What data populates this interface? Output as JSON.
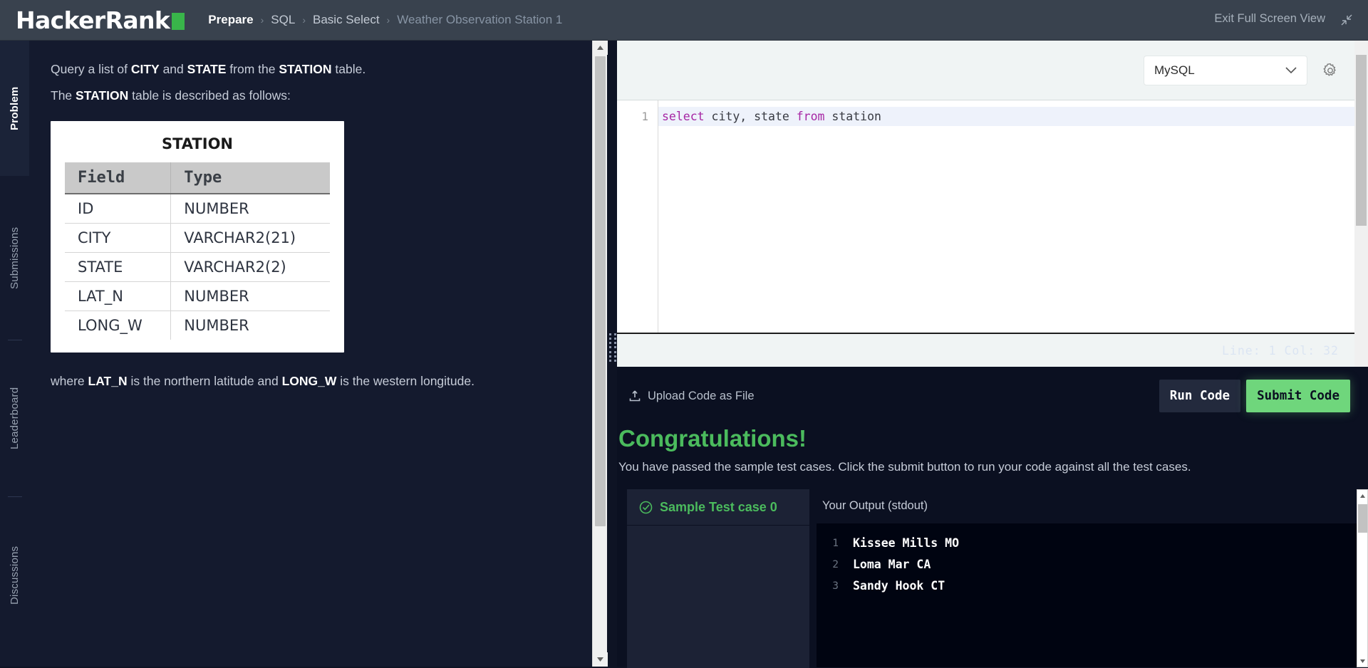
{
  "header": {
    "logo_text": "HackerRank",
    "breadcrumb": [
      {
        "label": "Prepare",
        "state": "strong"
      },
      {
        "label": "SQL",
        "state": "normal"
      },
      {
        "label": "Basic Select",
        "state": "normal"
      },
      {
        "label": "Weather Observation Station 1",
        "state": "current"
      }
    ],
    "separator": "›",
    "exit_fullscreen_label": "Exit Full Screen View",
    "exit_fullscreen_icon": "collapse-arrows-icon"
  },
  "rail": {
    "items": [
      {
        "label": "Problem",
        "active": true
      },
      {
        "label": "Submissions",
        "active": false
      },
      {
        "label": "Leaderboard",
        "active": false
      },
      {
        "label": "Discussions",
        "active": false
      }
    ]
  },
  "problem": {
    "line1_a": "Query a list of ",
    "line1_b": "CITY",
    "line1_c": " and ",
    "line1_d": "STATE",
    "line1_e": " from the ",
    "line1_f": "STATION",
    "line1_g": " table.",
    "line2_a": "The ",
    "line2_b": "STATION",
    "line2_c": " table is described as follows:",
    "table_image": {
      "title": "STATION",
      "headers": [
        "Field",
        "Type"
      ],
      "rows": [
        [
          "ID",
          "NUMBER"
        ],
        [
          "CITY",
          "VARCHAR2(21)"
        ],
        [
          "STATE",
          "VARCHAR2(2)"
        ],
        [
          "LAT_N",
          "NUMBER"
        ],
        [
          "LONG_W",
          "NUMBER"
        ]
      ]
    },
    "footnote_a": "where ",
    "footnote_b": "LAT_N",
    "footnote_c": " is the northern latitude and ",
    "footnote_d": "LONG_W",
    "footnote_e": " is the western longitude."
  },
  "editor": {
    "language": "MySQL",
    "language_chevron": "chevron-down-icon",
    "settings_icon": "gear-icon",
    "gutter": [
      "1"
    ],
    "code_tokens": [
      {
        "text": "select",
        "type": "keyword"
      },
      {
        "text": " city, state ",
        "type": "plain"
      },
      {
        "text": "from",
        "type": "keyword"
      },
      {
        "text": " station",
        "type": "plain"
      }
    ],
    "status": "Line: 1 Col: 32"
  },
  "actions": {
    "upload_label": "Upload Code as File",
    "upload_icon": "upload-icon",
    "run_label": "Run Code",
    "submit_label": "Submit Code"
  },
  "result": {
    "title": "Congratulations!",
    "subtitle": "You have passed the sample test cases. Click the submit button to run your code against all the test cases.",
    "testcase_icon": "check-circle-icon",
    "testcase_label": "Sample Test case 0",
    "output_label": "Your Output (stdout)",
    "output_gutter": [
      "1",
      "2",
      "3"
    ],
    "output_lines": [
      "Kissee Mills MO",
      "Loma Mar CA",
      "Sandy Hook CT"
    ]
  },
  "colors": {
    "brand_green": "#39b54a",
    "success_green": "#4bbb5d",
    "submit_green": "#6fd67c",
    "topbar": "#39424e",
    "panel_dark": "#141a2e",
    "keyword_purple": "#a626a4"
  }
}
